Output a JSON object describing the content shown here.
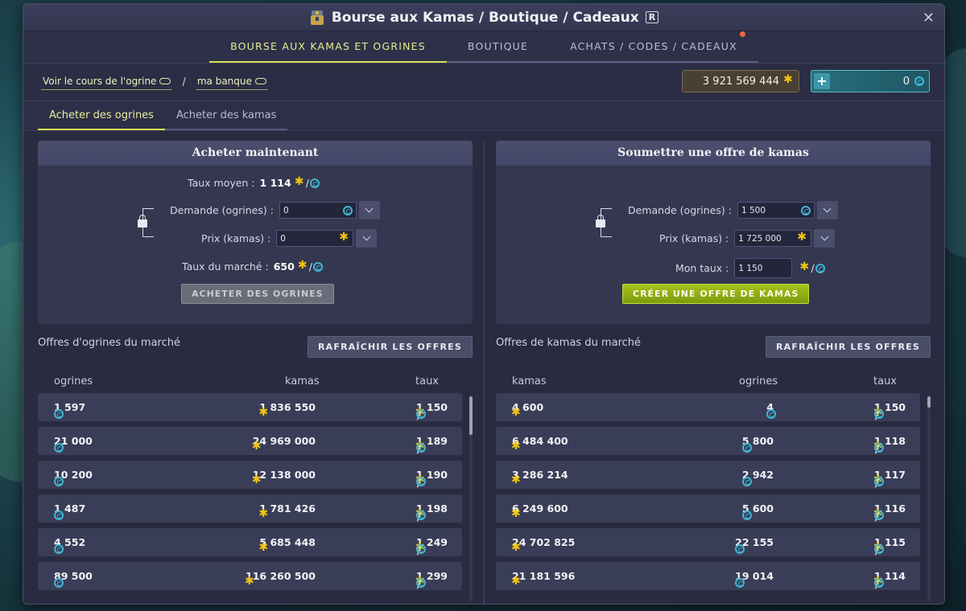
{
  "window": {
    "title": "Bourse aux Kamas / Boutique / Cadeaux",
    "shortcut": "R",
    "close": "✕"
  },
  "main_tabs": [
    {
      "label": "BOURSE AUX KAMAS ET OGRINES",
      "active": true
    },
    {
      "label": "BOUTIQUE",
      "active": false
    },
    {
      "label": "ACHATS / CODES / CADEAUX",
      "active": false,
      "notification": true
    }
  ],
  "links": {
    "rate_link": "Voir le cours de l'ogrine",
    "separator": "/",
    "bank_link": "ma banque"
  },
  "wallet": {
    "kamas": "3 921 569 444",
    "ogrines": "0",
    "add": "+"
  },
  "sub_tabs": [
    {
      "label": "Acheter des ogrines",
      "active": true
    },
    {
      "label": "Acheter des kamas",
      "active": false
    }
  ],
  "buy_now": {
    "title": "Acheter maintenant",
    "avg_rate_label": "Taux moyen :",
    "avg_rate_value": "1 114",
    "demand_label": "Demande (ogrines) :",
    "demand_value": "0",
    "price_label": "Prix (kamas) :",
    "price_value": "0",
    "market_rate_label": "Taux du marché :",
    "market_rate_value": "650",
    "button": "ACHETER DES OGRINES"
  },
  "submit_offer": {
    "title": "Soumettre une offre de kamas",
    "demand_label": "Demande (ogrines) :",
    "demand_value": "1 500",
    "price_label": "Prix (kamas) :",
    "price_value": "1 725 000",
    "rate_label": "Mon taux :",
    "rate_value": "1 150",
    "button": "CRÉER UNE OFFRE DE KAMAS"
  },
  "ogrine_offers": {
    "label": "Offres d'ogrines du marché",
    "refresh": "RAFRAÎCHIR LES OFFRES",
    "headers": [
      "ogrines",
      "kamas",
      "taux"
    ],
    "rows": [
      {
        "ogrines": "1 597",
        "kamas": "1 836 550",
        "rate": "1 150"
      },
      {
        "ogrines": "21 000",
        "kamas": "24 969 000",
        "rate": "1 189"
      },
      {
        "ogrines": "10 200",
        "kamas": "12 138 000",
        "rate": "1 190"
      },
      {
        "ogrines": "1 487",
        "kamas": "1 781 426",
        "rate": "1 198"
      },
      {
        "ogrines": "4 552",
        "kamas": "5 685 448",
        "rate": "1 249"
      },
      {
        "ogrines": "89 500",
        "kamas": "116 260 500",
        "rate": "1 299"
      }
    ]
  },
  "kamas_offers": {
    "label": "Offres de kamas du marché",
    "refresh": "RAFRAÎCHIR LES OFFRES",
    "headers": [
      "kamas",
      "ogrines",
      "taux"
    ],
    "rows": [
      {
        "kamas": "4 600",
        "ogrines": "4",
        "rate": "1 150"
      },
      {
        "kamas": "6 484 400",
        "ogrines": "5 800",
        "rate": "1 118"
      },
      {
        "kamas": "3 286 214",
        "ogrines": "2 942",
        "rate": "1 117"
      },
      {
        "kamas": "6 249 600",
        "ogrines": "5 600",
        "rate": "1 116"
      },
      {
        "kamas": "24 702 825",
        "ogrines": "22 155",
        "rate": "1 115"
      },
      {
        "kamas": "21 181 596",
        "ogrines": "19 014",
        "rate": "1 114"
      }
    ]
  },
  "colors": {
    "accent": "#d7e04e",
    "kama": "#f1c40f",
    "ogrine": "#3fb6d2",
    "panel": "#34374f"
  }
}
